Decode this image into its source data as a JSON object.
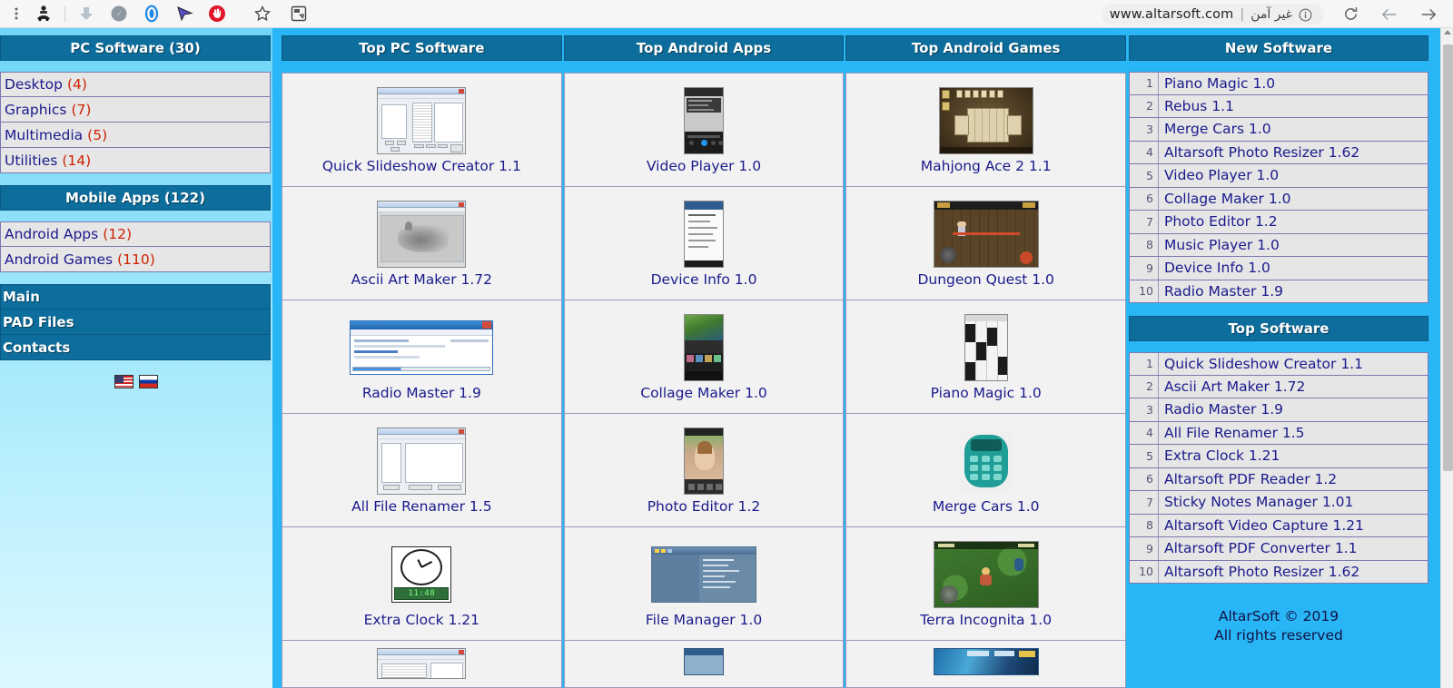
{
  "browser": {
    "icons": [
      "menu-dots-icon",
      "profile-car-icon",
      "download-icon",
      "compass-icon",
      "opera-turbo-icon",
      "cursor-icon",
      "adblock-icon",
      "bookmark-star-icon",
      "extension-icon"
    ],
    "omnibox": {
      "security_label": "غير آمن",
      "divider": "|",
      "url": "www.altarsoft.com",
      "info_icon": "info-circle-icon"
    },
    "reload_icon": "reload-icon",
    "back_icon": "back-arrow-icon",
    "forward_icon": "forward-arrow-icon"
  },
  "sidebar": {
    "groups": [
      {
        "title": "PC Software (30)",
        "items": [
          {
            "label": "Desktop",
            "count": "(4)"
          },
          {
            "label": "Graphics",
            "count": "(7)"
          },
          {
            "label": "Multimedia",
            "count": "(5)"
          },
          {
            "label": "Utilities",
            "count": "(14)"
          }
        ]
      },
      {
        "title": "Mobile Apps (122)",
        "items": [
          {
            "label": "Android Apps",
            "count": "(12)"
          },
          {
            "label": "Android Games",
            "count": "(110)"
          }
        ]
      }
    ],
    "nav": [
      {
        "label": "Main"
      },
      {
        "label": "PAD Files"
      },
      {
        "label": "Contacts"
      }
    ],
    "flags": [
      {
        "name": "flag-us",
        "title": "English"
      },
      {
        "name": "flag-ru",
        "title": "Russian"
      }
    ]
  },
  "columns": [
    {
      "title": "Top PC Software",
      "thumb_kind": "windows",
      "cards": [
        {
          "label": "Quick Slideshow Creator 1.1"
        },
        {
          "label": "Ascii Art Maker 1.72"
        },
        {
          "label": "Radio Master 1.9"
        },
        {
          "label": "All File Renamer 1.5"
        },
        {
          "label": "Extra Clock 1.21"
        },
        {
          "label": ""
        }
      ]
    },
    {
      "title": "Top Android Apps",
      "thumb_kind": "phone",
      "cards": [
        {
          "label": "Video Player 1.0"
        },
        {
          "label": "Device Info 1.0"
        },
        {
          "label": "Collage Maker 1.0"
        },
        {
          "label": "Photo Editor 1.2"
        },
        {
          "label": "File Manager 1.0"
        },
        {
          "label": ""
        }
      ]
    },
    {
      "title": "Top Android Games",
      "thumb_kind": "game",
      "cards": [
        {
          "label": "Mahjong Ace 2 1.1"
        },
        {
          "label": "Dungeon Quest 1.0"
        },
        {
          "label": "Piano Magic 1.0"
        },
        {
          "label": "Merge Cars 1.0"
        },
        {
          "label": "Terra Incognita 1.0"
        },
        {
          "label": ""
        }
      ]
    }
  ],
  "right_panel": {
    "new_software": {
      "title": "New Software",
      "items": [
        {
          "rank": "1",
          "name": "Piano Magic 1.0"
        },
        {
          "rank": "2",
          "name": "Rebus 1.1"
        },
        {
          "rank": "3",
          "name": "Merge Cars 1.0"
        },
        {
          "rank": "4",
          "name": "Altarsoft Photo Resizer 1.62"
        },
        {
          "rank": "5",
          "name": "Video Player 1.0"
        },
        {
          "rank": "6",
          "name": "Collage Maker 1.0"
        },
        {
          "rank": "7",
          "name": "Photo Editor 1.2"
        },
        {
          "rank": "8",
          "name": "Music Player 1.0"
        },
        {
          "rank": "9",
          "name": "Device Info 1.0"
        },
        {
          "rank": "10",
          "name": "Radio Master 1.9"
        }
      ]
    },
    "top_software": {
      "title": "Top Software",
      "items": [
        {
          "rank": "1",
          "name": "Quick Slideshow Creator 1.1"
        },
        {
          "rank": "2",
          "name": "Ascii Art Maker 1.72"
        },
        {
          "rank": "3",
          "name": "Radio Master 1.9"
        },
        {
          "rank": "4",
          "name": "All File Renamer 1.5"
        },
        {
          "rank": "5",
          "name": "Extra Clock 1.21"
        },
        {
          "rank": "6",
          "name": "Altarsoft PDF Reader 1.2"
        },
        {
          "rank": "7",
          "name": "Sticky Notes Manager 1.01"
        },
        {
          "rank": "8",
          "name": "Altarsoft Video Capture 1.21"
        },
        {
          "rank": "9",
          "name": "Altarsoft PDF Converter 1.1"
        },
        {
          "rank": "10",
          "name": "Altarsoft Photo Resizer 1.62"
        }
      ]
    },
    "footer": {
      "line1": "AltarSoft © 2019",
      "line2": "All rights reserved"
    }
  },
  "colors": {
    "header_blue": "#0d6e9e",
    "page_blue": "#29b6f6",
    "link_navy": "#1a1a8c",
    "count_red": "#cc2200",
    "row_grey": "#e6e6e6",
    "accent_yellow": "#ffb900"
  }
}
